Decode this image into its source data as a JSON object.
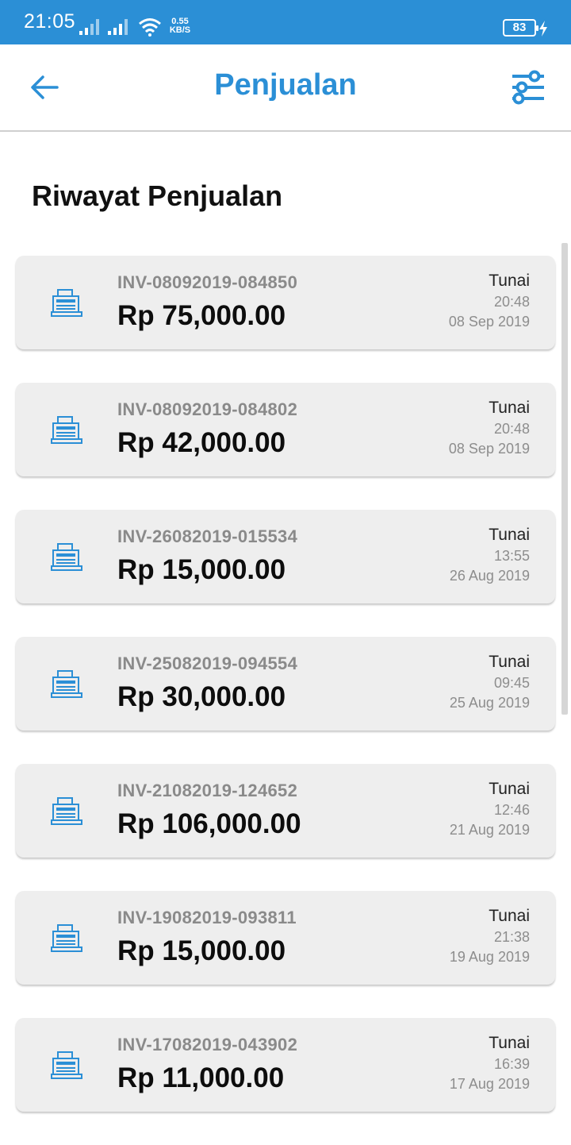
{
  "status_bar": {
    "time": "21:05",
    "net_speed_value": "0.55",
    "net_speed_unit": "KB/S",
    "battery": "83"
  },
  "app_bar": {
    "title": "Penjualan",
    "back_icon": "arrow-left-icon",
    "filter_icon": "sliders-icon"
  },
  "section_title": "Riwayat Penjualan",
  "colors": {
    "accent": "#2b8fd6",
    "card_bg": "#eeeeee"
  },
  "sales": [
    {
      "invoice": "INV-08092019-084850",
      "amount": "Rp 75,000.00",
      "method": "Tunai",
      "time": "20:48",
      "date": "08 Sep 2019"
    },
    {
      "invoice": "INV-08092019-084802",
      "amount": "Rp 42,000.00",
      "method": "Tunai",
      "time": "20:48",
      "date": "08 Sep 2019"
    },
    {
      "invoice": "INV-26082019-015534",
      "amount": "Rp 15,000.00",
      "method": "Tunai",
      "time": "13:55",
      "date": "26 Aug 2019"
    },
    {
      "invoice": "INV-25082019-094554",
      "amount": "Rp 30,000.00",
      "method": "Tunai",
      "time": "09:45",
      "date": "25 Aug 2019"
    },
    {
      "invoice": "INV-21082019-124652",
      "amount": "Rp 106,000.00",
      "method": "Tunai",
      "time": "12:46",
      "date": "21 Aug 2019"
    },
    {
      "invoice": "INV-19082019-093811",
      "amount": "Rp 15,000.00",
      "method": "Tunai",
      "time": "21:38",
      "date": "19 Aug 2019"
    },
    {
      "invoice": "INV-17082019-043902",
      "amount": "Rp 11,000.00",
      "method": "Tunai",
      "time": "16:39",
      "date": "17 Aug 2019"
    }
  ]
}
